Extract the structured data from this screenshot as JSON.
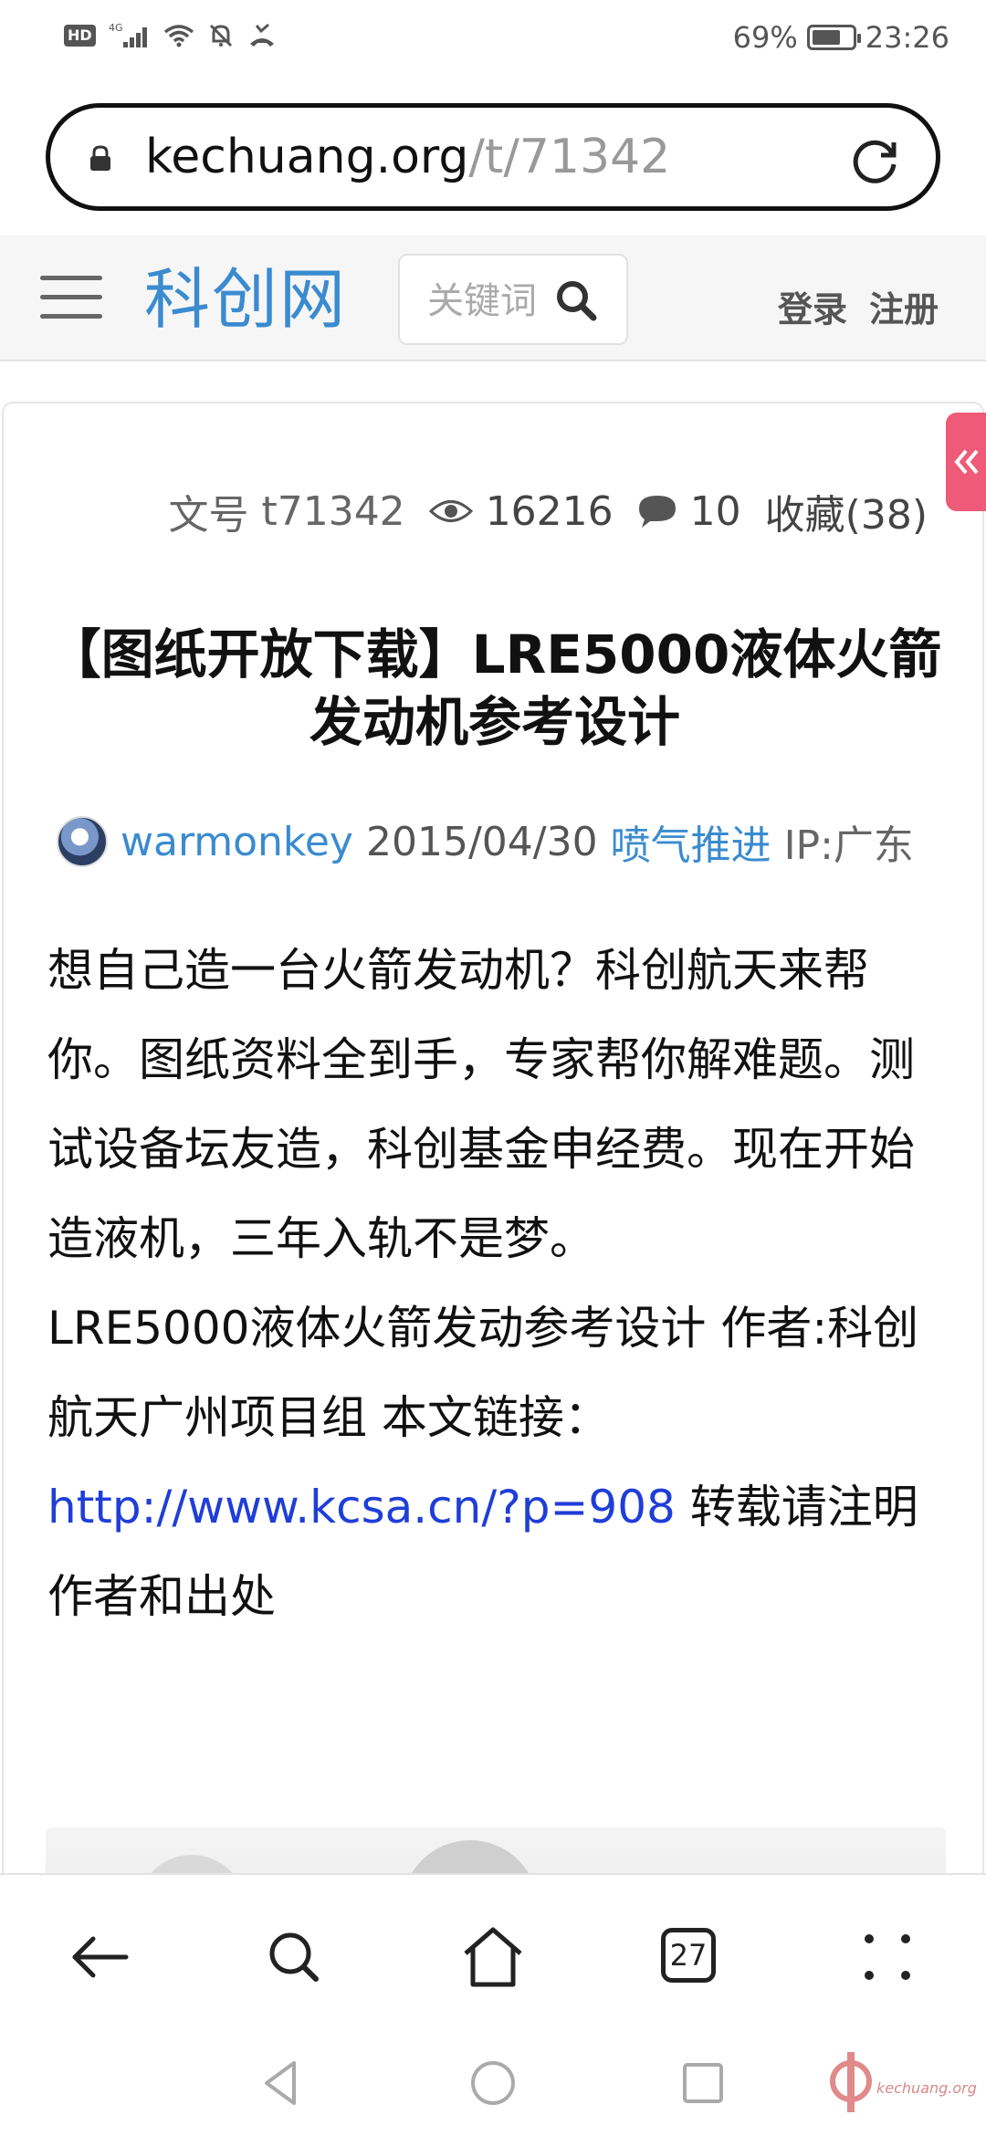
{
  "status_bar": {
    "hd": "HD",
    "network": "4G",
    "battery_percent": "69%",
    "time": "23:26"
  },
  "browser": {
    "url_host": "kechuang.org",
    "url_path": "/t/71342",
    "tab_count": "27"
  },
  "site": {
    "logo": "科创网",
    "search_placeholder": "关键词",
    "login": "登录",
    "register": "注册"
  },
  "article": {
    "meta": {
      "id_label": "文号",
      "id_value": "t71342",
      "views": "16216",
      "comments": "10",
      "favorites": "收藏(38)"
    },
    "title": "【图纸开放下载】LRE5000液体火箭发动机参考设计",
    "author": "warmonkey",
    "date": "2015/04/30",
    "category": "喷气推进",
    "ip": "IP:广东",
    "body_p1": "想自己造一台火箭发动机？科创航天来帮你。图纸资料全到手，专家帮你解难题。测试设备坛友造，科创基金申经费。现在开始造液机，三年入轨不是梦。",
    "body_p2_text": "LRE5000液体火箭发动参考设计 作者:科创航天广州项目组 本文链接：",
    "body_p2_link": "http://www.kcsa.cn/?p=908",
    "body_p2_tail": " 转载请注明作者和出处"
  },
  "watermark": {
    "text": "kechuang.org"
  }
}
